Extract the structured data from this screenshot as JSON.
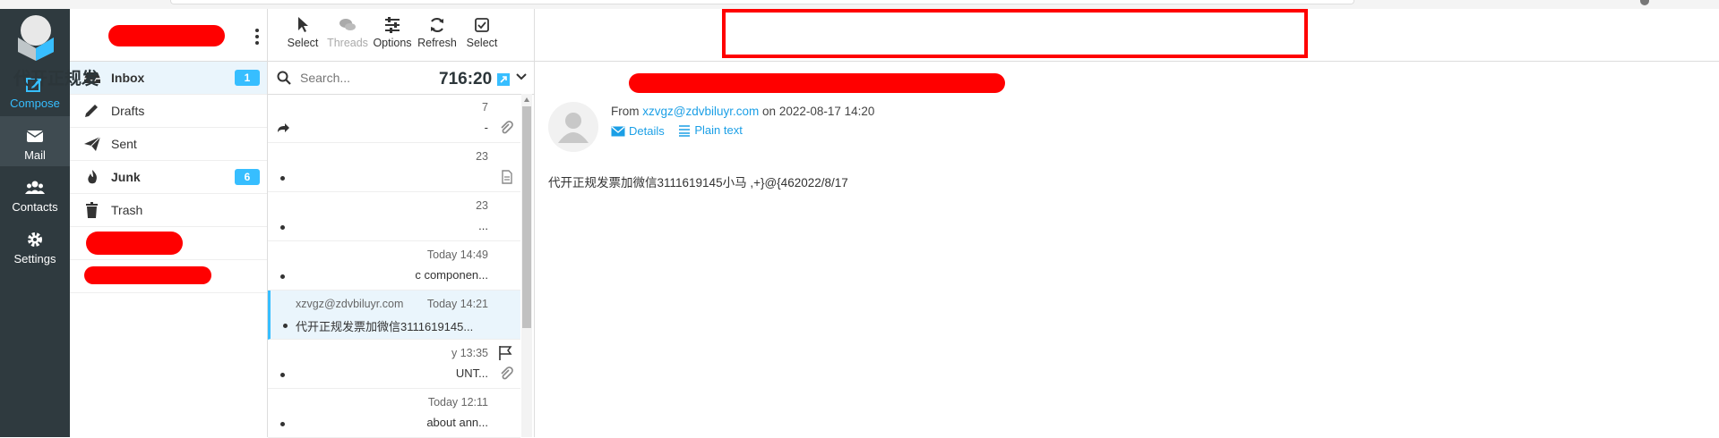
{
  "rail": {
    "compose": "Compose",
    "mail": "Mail",
    "contacts": "Contacts",
    "settings": "Settings"
  },
  "folders": [
    {
      "label": "Inbox",
      "badge": "1",
      "bold": true,
      "selected": true,
      "icon": "inbox-icon"
    },
    {
      "label": "Drafts",
      "badge": "",
      "bold": false,
      "icon": "pencil-icon"
    },
    {
      "label": "Sent",
      "badge": "",
      "bold": false,
      "icon": "paper-plane-icon"
    },
    {
      "label": "Junk",
      "badge": "6",
      "bold": true,
      "icon": "fire-icon"
    },
    {
      "label": "Trash",
      "badge": "",
      "bold": false,
      "icon": "trash-icon"
    }
  ],
  "toolbar": {
    "select": "Select",
    "threads": "Threads",
    "options": "Options",
    "refresh": "Refresh",
    "select2": "Select"
  },
  "search": {
    "placeholder": "Search..."
  },
  "messages": [
    {
      "from": "",
      "date": "7",
      "subject": "-"
    },
    {
      "from": "",
      "date": "23",
      "subject": ""
    },
    {
      "from": "",
      "date": "23",
      "subject": "..."
    },
    {
      "from": "",
      "date": "Today 14:49",
      "subject": "c componen..."
    },
    {
      "from": "xzvgz@zdvbiluyr.com",
      "date": "Today 14:21",
      "subject": "代开正规发票加微信3111619145..."
    },
    {
      "from": "",
      "date": "y 13:35",
      "subject": "UNT..."
    },
    {
      "from": "",
      "date": "Today 12:11",
      "subject": "about ann..."
    }
  ],
  "message": {
    "subject_start": "代开正规发",
    "subject_end": "716:20",
    "from_label": "From",
    "from_email": "xzvgz@zdvbiluyr.com",
    "on_label": "on",
    "date": "2022-08-17 14:20",
    "details": "Details",
    "plain_text": "Plain text",
    "body": "代开正规发票加微信3111619145小马  ,+}@{462022/8/17"
  },
  "colors": {
    "accent": "#37beff",
    "rail": "#2f3a3f",
    "redaction": "#ff0000",
    "link": "#1b9fe6"
  }
}
